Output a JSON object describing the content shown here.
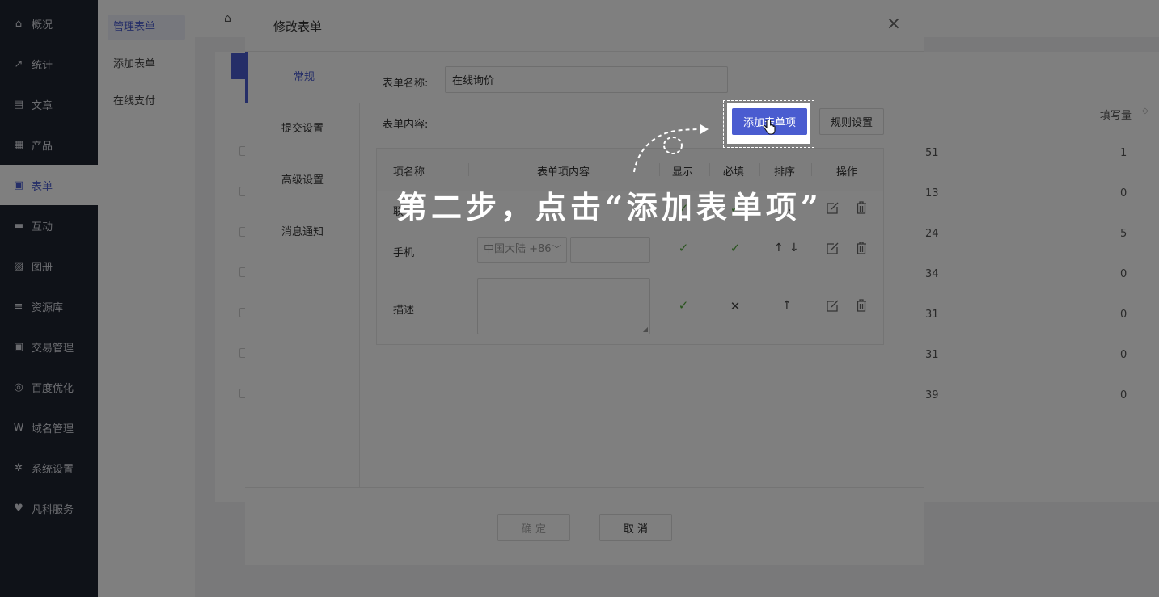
{
  "sidebar": {
    "items": [
      {
        "label": "概况",
        "icon": "home-icon",
        "glyph": "⌂"
      },
      {
        "label": "统计",
        "icon": "stats-icon",
        "glyph": "↗"
      },
      {
        "label": "文章",
        "icon": "article-icon",
        "glyph": "▤"
      },
      {
        "label": "产品",
        "icon": "product-icon",
        "glyph": "▦"
      },
      {
        "label": "表单",
        "icon": "form-icon",
        "glyph": "▣"
      },
      {
        "label": "互动",
        "icon": "chat-icon",
        "glyph": "▬"
      },
      {
        "label": "图册",
        "icon": "gallery-icon",
        "glyph": "▨"
      },
      {
        "label": "资源库",
        "icon": "database-icon",
        "glyph": "≡"
      },
      {
        "label": "交易管理",
        "icon": "trade-icon",
        "glyph": "▣"
      },
      {
        "label": "百度优化",
        "icon": "seo-icon",
        "glyph": "◎"
      },
      {
        "label": "域名管理",
        "icon": "domain-icon",
        "glyph": "W"
      },
      {
        "label": "系统设置",
        "icon": "settings-icon",
        "glyph": "✲"
      },
      {
        "label": "凡科服务",
        "icon": "heart-icon",
        "glyph": "♥"
      }
    ],
    "active_index": 4
  },
  "subnav": {
    "items": [
      "管理表单",
      "添加表单",
      "在线支付"
    ]
  },
  "list": {
    "fill_column": "填写量",
    "left_values": [
      "51",
      "13",
      "24",
      "34",
      "31",
      "31",
      "39"
    ],
    "fill_values": [
      "1",
      "0",
      "5",
      "0",
      "0",
      "0",
      "0"
    ]
  },
  "modal": {
    "title": "修改表单",
    "tabs": [
      "常规",
      "提交设置",
      "高级设置",
      "消息通知"
    ],
    "active_tab": 0,
    "name_label": "表单名称:",
    "name_value": "在线询价",
    "content_label": "表单内容:",
    "add_item_button": "添加表单项",
    "rule_button": "规则设置",
    "table": {
      "headers": [
        "项名称",
        "表单项内容",
        "显示",
        "必填",
        "排序",
        "操作"
      ],
      "rows": [
        {
          "name": "联",
          "show": true,
          "required": true,
          "sort": [
            "↓"
          ]
        },
        {
          "name": "手机",
          "country": "中国大陆 +86",
          "show": true,
          "required": true,
          "sort": [
            "↑",
            "↓"
          ]
        },
        {
          "name": "描述",
          "show": true,
          "required": false,
          "sort": [
            "↑"
          ]
        }
      ]
    },
    "confirm_button": "确 定",
    "cancel_button": "取 消"
  },
  "tutorial": {
    "text": "第二步，点击“添加表单项”"
  }
}
